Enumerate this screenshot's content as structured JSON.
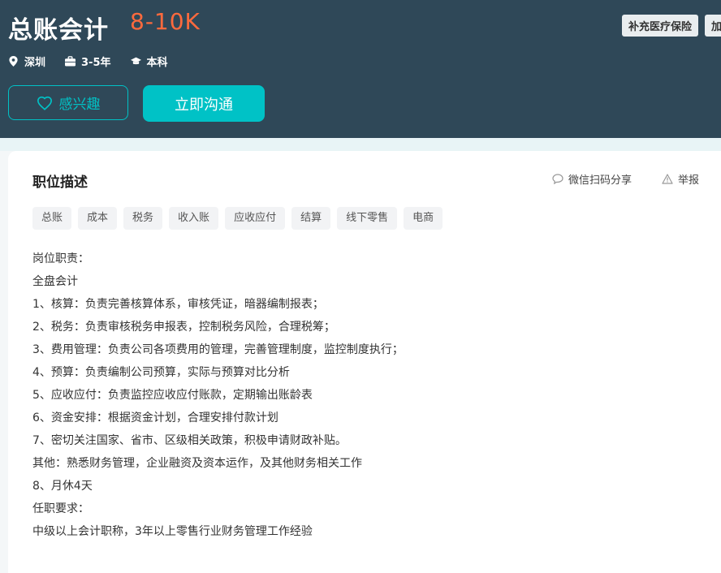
{
  "job": {
    "title": "总账会计",
    "salary": "8-10K",
    "benefits": [
      "补充医疗保险",
      "加"
    ],
    "meta": {
      "location": "深圳",
      "experience": "3-5年",
      "education": "本科"
    },
    "buttons": {
      "interest": "感兴趣",
      "chat": "立即沟通"
    }
  },
  "detail": {
    "section_title": "职位描述",
    "share_label": "微信扫码分享",
    "report_label": "举报",
    "tags": [
      "总账",
      "成本",
      "税务",
      "收入账",
      "应收应付",
      "结算",
      "线下零售",
      "电商"
    ],
    "lines": [
      "岗位职责：",
      "全盘会计",
      "1、核算：负责完善核算体系，审核凭证，暗器编制报表；",
      "2、税务：负责审核税务申报表，控制税务风险，合理税筹；",
      "3、费用管理：负责公司各项费用的管理，完善管理制度，监控制度执行；",
      "4、预算：负责编制公司预算，实际与预算对比分析",
      "5、应收应付：负责监控应收应付账款，定期输出账龄表",
      "6、资金安排：根据资金计划，合理安排付款计划",
      "7、密切关注国家、省市、区级相关政策，积极申请财政补贴。",
      "其他：熟悉财务管理，企业融资及资本运作，及其他财务相关工作",
      "8、月休4天",
      "任职要求：",
      "中级以上会计职称，3年以上零售行业财务管理工作经验"
    ]
  },
  "icons": {
    "location": "location-pin-icon",
    "experience": "briefcase-icon",
    "education": "graduation-cap-icon",
    "interest": "heart-icon",
    "share": "chat-bubble-icon",
    "report": "warning-triangle-icon"
  },
  "colors": {
    "header_bg": "#2f4858",
    "salary": "#ff6a3d",
    "accent": "#00c2c6"
  }
}
